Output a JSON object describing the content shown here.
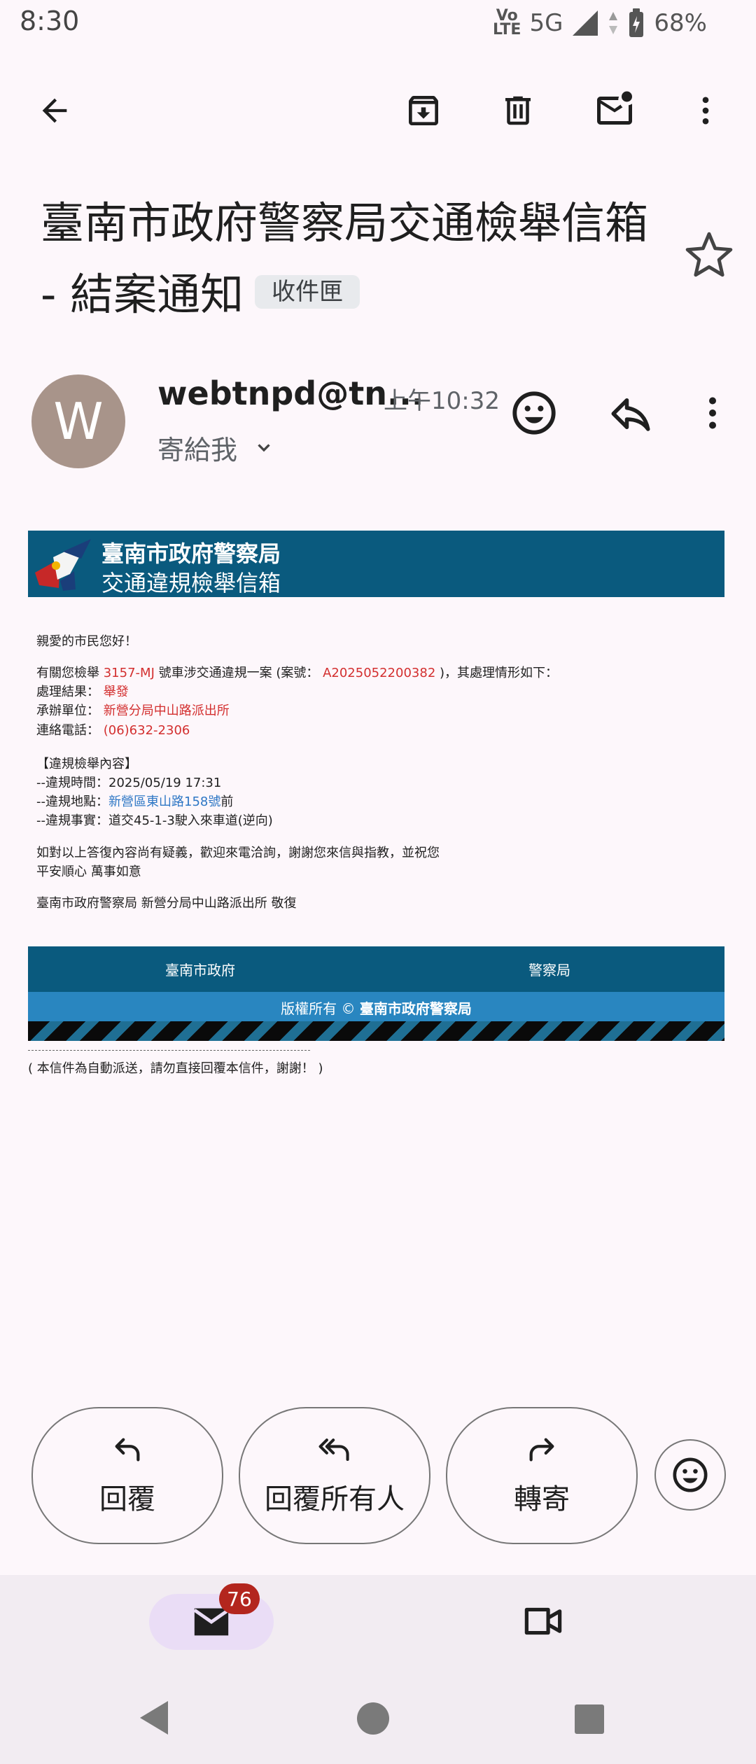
{
  "status": {
    "time": "8:30",
    "network": "5G",
    "battery": "68%"
  },
  "subject": {
    "title": "臺南市政府警察局交通檢舉信箱 - 結案通知",
    "label": "收件匣"
  },
  "sender": {
    "initial": "W",
    "name": "webtnpd@tn...",
    "time": "上午10:32",
    "to": "寄給我"
  },
  "email": {
    "banner_title": "臺南市政府警察局",
    "banner_subtitle": "交通違規檢舉信箱",
    "greeting": "親愛的市民您好！",
    "intro_prefix": "有關您檢舉 ",
    "plate": "3157-MJ",
    "intro_middle": " 號車涉交通違規一案 (案號： ",
    "case_no": "A2025052200382",
    "intro_suffix": " )，其處理情形如下：",
    "result_label": "處理結果： ",
    "result": "舉發",
    "unit_label": "承辦單位： ",
    "unit": "新營分局中山路派出所",
    "phone_label": "連絡電話： ",
    "phone": "(06)632-2306",
    "section_title": "【違規檢舉內容】",
    "time_line": "--違規時間：2025/05/19 17:31",
    "place_label": "--違規地點：",
    "place": "新營區東山路158號",
    "place_suffix": "前",
    "fact_line": "--違規事實：道交45-1-3駛入來車道(逆向)",
    "closing1": "如對以上答復內容尚有疑義，歡迎來電洽詢，謝謝您來信與指教，並祝您",
    "closing2": "平安順心 萬事如意",
    "signature": "臺南市政府警察局 新營分局中山路派出所 敬復",
    "footer_link1": "臺南市政府",
    "footer_link2": "警察局",
    "copyright_prefix": "版權所有 © ",
    "copyright_org": "臺南市政府警察局",
    "auto_note": "( 本信件為自動派送，請勿直接回覆本信件，謝謝！ )"
  },
  "actions": {
    "reply": "回覆",
    "reply_all": "回覆所有人",
    "forward": "轉寄"
  },
  "nav": {
    "mail_badge": "76"
  }
}
